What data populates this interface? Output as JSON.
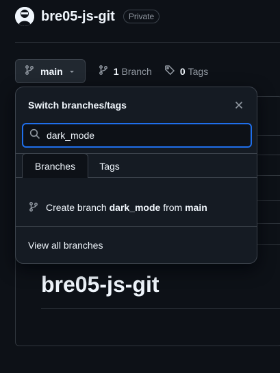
{
  "repo": {
    "name": "bre05-js-git",
    "visibility": "Private"
  },
  "branch_bar": {
    "current_branch": "main",
    "branch_count": "1",
    "branch_label": "Branch",
    "tag_count": "0",
    "tag_label": "Tags"
  },
  "dropdown": {
    "title": "Switch branches/tags",
    "search_value": "dark_mode",
    "tabs": [
      "Branches",
      "Tags"
    ],
    "create_prefix": "Create branch",
    "create_branch": "dark_mode",
    "create_from": "from",
    "create_source": "main",
    "view_all": "View all branches"
  },
  "readme": {
    "title": "bre05-js-git"
  },
  "colors": {
    "background": "#0d1117",
    "panel": "#151b23",
    "focus": "#1f6feb",
    "muted": "#9198a1"
  }
}
